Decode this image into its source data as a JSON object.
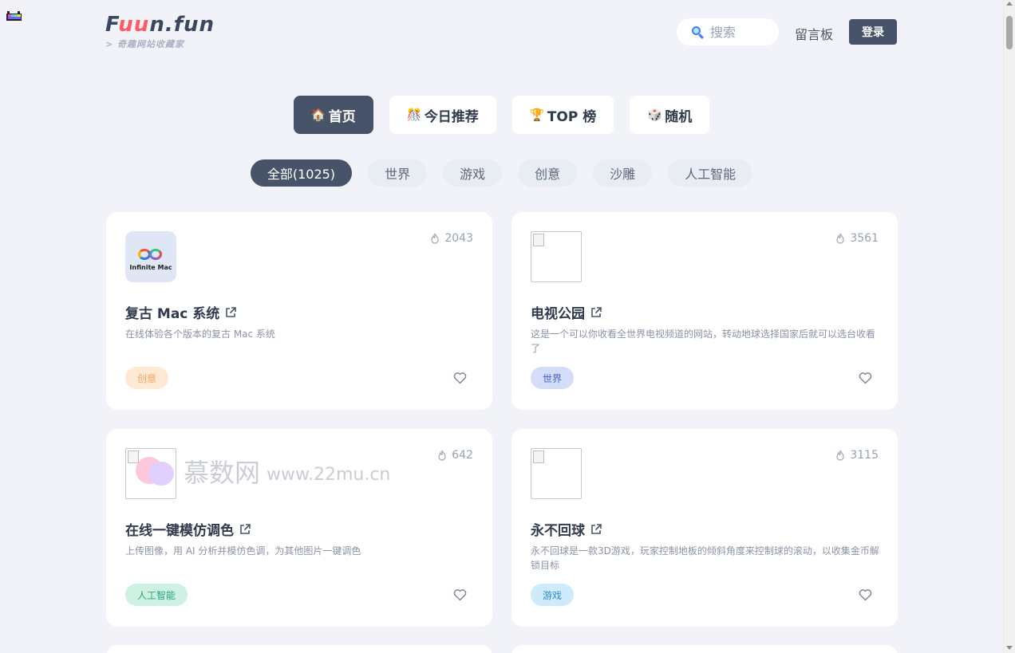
{
  "header": {
    "logo_text_1": "F",
    "logo_text_2": "uu",
    "logo_text_3": "n",
    "logo_text_4": ".fun",
    "logo_subtitle": "> 奇趣网站收藏家",
    "search_placeholder": "搜索",
    "guestbook_label": "留言板",
    "login_label": "登录"
  },
  "main_tabs": [
    {
      "emoji": "🏠",
      "label": "首页",
      "active": true
    },
    {
      "emoji": "🎊",
      "label": "今日推荐",
      "active": false
    },
    {
      "emoji": "🏆",
      "label": "TOP 榜",
      "active": false
    },
    {
      "emoji": "🎲",
      "label": "随机",
      "active": false
    }
  ],
  "categories": [
    {
      "label": "全部(1025)",
      "active": true
    },
    {
      "label": "世界",
      "active": false
    },
    {
      "label": "游戏",
      "active": false
    },
    {
      "label": "创意",
      "active": false
    },
    {
      "label": "沙雕",
      "active": false
    },
    {
      "label": "人工智能",
      "active": false
    }
  ],
  "cards": [
    {
      "thumb": "mac",
      "thumb_label": "Infinite Mac",
      "heat": "2043",
      "title": "复古 Mac 系统",
      "desc": "在线体验各个版本的复古 Mac 系统",
      "tag": "创意",
      "tag_bg": "#fde9d4",
      "tag_color": "#f0a66a"
    },
    {
      "thumb": "broken",
      "heat": "3561",
      "title": "电视公园",
      "desc": "这是一个可以你收看全世界电视频道的网站，转动地球选择国家后就可以选台收看了",
      "tag": "世界",
      "tag_bg": "#d3dcf8",
      "tag_color": "#4a64c8"
    },
    {
      "thumb": "broken",
      "heat": "642",
      "title": "在线一键模仿调色",
      "desc": "上传图像，用 AI 分析并模仿色调，为其他图片一键调色",
      "tag": "人工智能",
      "tag_bg": "#cdf1e3",
      "tag_color": "#2aa378"
    },
    {
      "thumb": "broken",
      "heat": "3115",
      "title": "永不回球",
      "desc": "永不回球是一款3D游戏，玩家控制地板的倾斜角度来控制球的滚动，以收集金币解锁目标",
      "tag": "游戏",
      "tag_bg": "#cdebfa",
      "tag_color": "#2e8fc4"
    }
  ],
  "watermark": {
    "cn": "慕数网",
    "en": "www.22mu.cn"
  },
  "colors": {
    "background": "#f1f3f8",
    "accent": "#465368",
    "logo_red": "#ff5a5f"
  }
}
